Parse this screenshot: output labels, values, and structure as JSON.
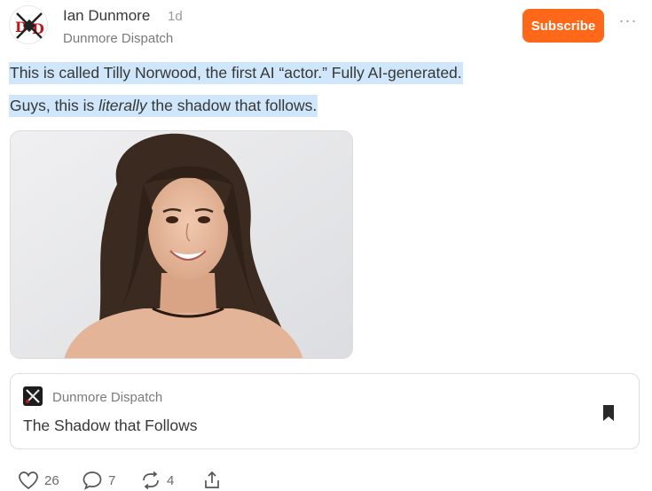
{
  "post": {
    "author": "Ian Dunmore",
    "age": "1d",
    "publication": "Dunmore Dispatch",
    "subscribe_label": "Subscribe",
    "more_label": "···",
    "line1": "This is called Tilly Norwood, the first AI “actor.” Fully AI-generated.",
    "line2_before": "Guys, this is ",
    "line2_em": "literally",
    "line2_after": " the shadow that follows."
  },
  "embed": {
    "publication": "Dunmore Dispatch",
    "title": "The Shadow that Follows"
  },
  "actions": {
    "likes": "26",
    "comments": "7",
    "restacks": "4"
  },
  "colors": {
    "accent": "#ff6719",
    "highlight": "#cfe6fb",
    "text": "#363737",
    "muted": "#7a7a7a"
  },
  "icons": {
    "like": "heart-icon",
    "comment": "comment-bubble-icon",
    "restack": "restack-icon",
    "share": "share-icon",
    "bookmark": "bookmark-icon",
    "more": "ellipsis-icon"
  }
}
